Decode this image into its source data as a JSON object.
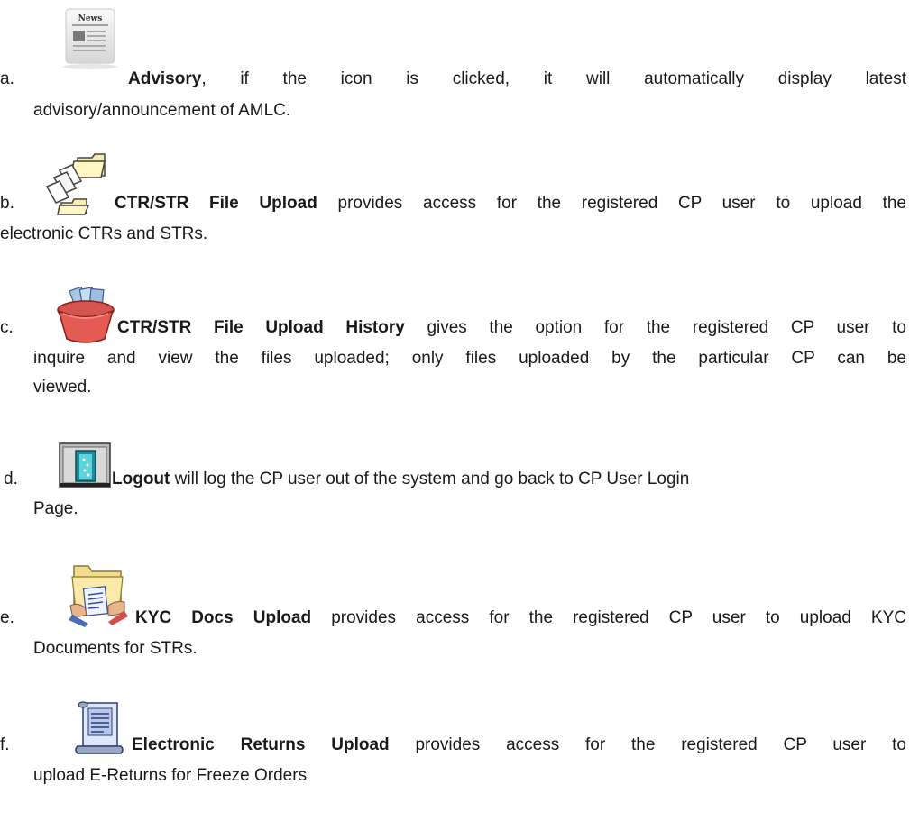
{
  "items": [
    {
      "letter": "a.",
      "icon": "news-icon",
      "title": "Advisory",
      "text": ", if the icon is clicked, it will automatically display latest",
      "continuation": "advisory/announcement of AMLC."
    },
    {
      "letter": "b.",
      "icon": "folder-upload-icon",
      "title": "CTR/STR File Upload",
      "text": " provides access for the registered CP user to upload the",
      "continuation": "electronic CTRs and STRs."
    },
    {
      "letter": "c.",
      "icon": "file-box-icon",
      "title": "CTR/STR File Upload History",
      "text": " gives the option for the registered CP user to",
      "continuation_lines": [
        "inquire and view the files uploaded; only files uploaded by the particular CP can be",
        "viewed."
      ]
    },
    {
      "letter": "d.",
      "icon": "door-exit-icon",
      "title": "Logout",
      "text": " will log the CP user out of the system and go back to CP User Login",
      "continuation": "Page."
    },
    {
      "letter": "e.",
      "icon": "folder-documents-icon",
      "title": "KYC Docs Upload",
      "text": " provides access for the registered CP user to upload KYC",
      "continuation": "Documents for STRs."
    },
    {
      "letter": "f.",
      "icon": "scroll-document-icon",
      "title": "Electronic Returns Upload",
      "text": " provides access for the registered CP user to",
      "continuation": "upload E-Returns for Freeze Orders"
    }
  ]
}
